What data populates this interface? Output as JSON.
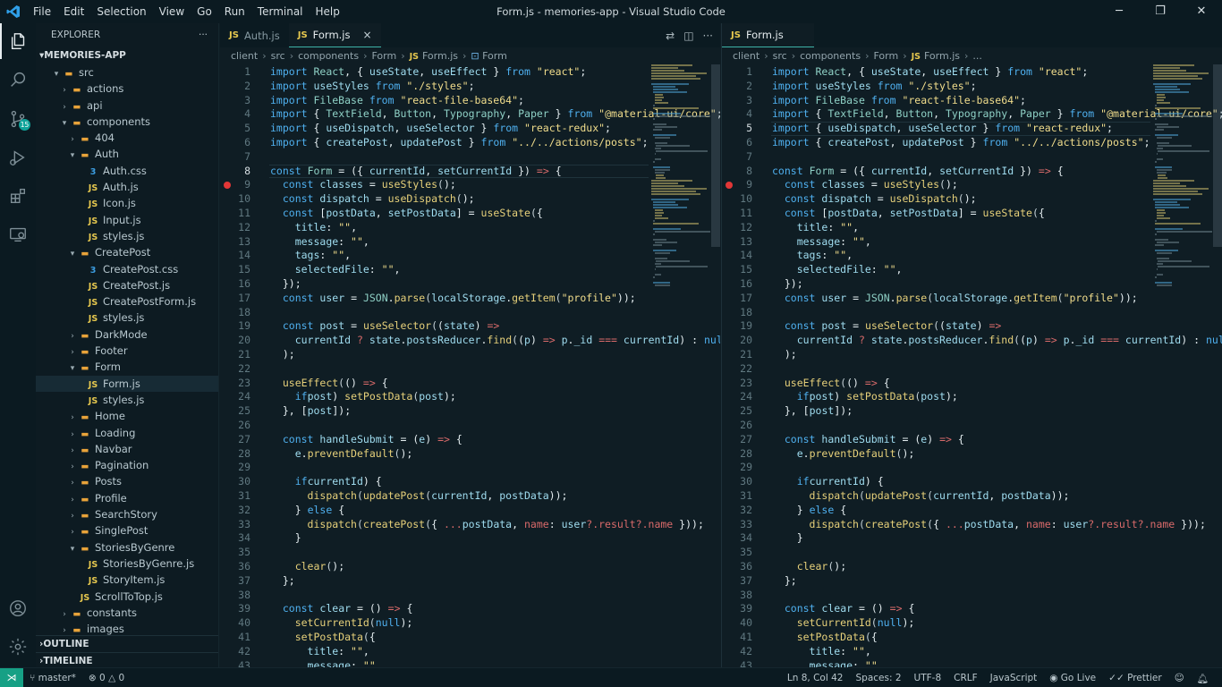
{
  "window": {
    "title": "Form.js - memories-app - Visual Studio Code",
    "menu": [
      "File",
      "Edit",
      "Selection",
      "View",
      "Go",
      "Run",
      "Terminal",
      "Help"
    ]
  },
  "activity": {
    "scm_badge": "15"
  },
  "sidebar": {
    "header": "EXPLORER",
    "more": "···",
    "project": "MEMORIES-APP",
    "tree": [
      {
        "label": "src",
        "kind": "folder",
        "depth": 1,
        "open": true
      },
      {
        "label": "actions",
        "kind": "folder",
        "depth": 2,
        "open": false
      },
      {
        "label": "api",
        "kind": "folder",
        "depth": 2,
        "open": false
      },
      {
        "label": "components",
        "kind": "folder",
        "depth": 2,
        "open": true
      },
      {
        "label": "404",
        "kind": "folder",
        "depth": 3,
        "open": false
      },
      {
        "label": "Auth",
        "kind": "folder",
        "depth": 3,
        "open": true
      },
      {
        "label": "Auth.css",
        "kind": "css",
        "depth": 4
      },
      {
        "label": "Auth.js",
        "kind": "js",
        "depth": 4
      },
      {
        "label": "Icon.js",
        "kind": "js",
        "depth": 4
      },
      {
        "label": "Input.js",
        "kind": "js",
        "depth": 4
      },
      {
        "label": "styles.js",
        "kind": "js",
        "depth": 4
      },
      {
        "label": "CreatePost",
        "kind": "folder",
        "depth": 3,
        "open": true
      },
      {
        "label": "CreatePost.css",
        "kind": "css",
        "depth": 4
      },
      {
        "label": "CreatePost.js",
        "kind": "js",
        "depth": 4
      },
      {
        "label": "CreatePostForm.js",
        "kind": "js",
        "depth": 4
      },
      {
        "label": "styles.js",
        "kind": "js",
        "depth": 4
      },
      {
        "label": "DarkMode",
        "kind": "folder",
        "depth": 3,
        "open": false
      },
      {
        "label": "Footer",
        "kind": "folder",
        "depth": 3,
        "open": false
      },
      {
        "label": "Form",
        "kind": "folder",
        "depth": 3,
        "open": true
      },
      {
        "label": "Form.js",
        "kind": "js",
        "depth": 4,
        "active": true
      },
      {
        "label": "styles.js",
        "kind": "js",
        "depth": 4
      },
      {
        "label": "Home",
        "kind": "folder",
        "depth": 3,
        "open": false
      },
      {
        "label": "Loading",
        "kind": "folder",
        "depth": 3,
        "open": false
      },
      {
        "label": "Navbar",
        "kind": "folder",
        "depth": 3,
        "open": false
      },
      {
        "label": "Pagination",
        "kind": "folder",
        "depth": 3,
        "open": false
      },
      {
        "label": "Posts",
        "kind": "folder",
        "depth": 3,
        "open": false
      },
      {
        "label": "Profile",
        "kind": "folder",
        "depth": 3,
        "open": false
      },
      {
        "label": "SearchStory",
        "kind": "folder",
        "depth": 3,
        "open": false
      },
      {
        "label": "SinglePost",
        "kind": "folder",
        "depth": 3,
        "open": false
      },
      {
        "label": "StoriesByGenre",
        "kind": "folder",
        "depth": 3,
        "open": true
      },
      {
        "label": "StoriesByGenre.js",
        "kind": "js",
        "depth": 4
      },
      {
        "label": "StoryItem.js",
        "kind": "js",
        "depth": 4
      },
      {
        "label": "ScrollToTop.js",
        "kind": "js",
        "depth": 3
      },
      {
        "label": "constants",
        "kind": "folder",
        "depth": 2,
        "open": false
      },
      {
        "label": "images",
        "kind": "folder",
        "depth": 2,
        "open": false
      }
    ],
    "outline": "OUTLINE",
    "timeline": "TIMELINE"
  },
  "editor_left": {
    "tabs": [
      {
        "label": "Auth.js",
        "active": false
      },
      {
        "label": "Form.js",
        "active": true
      }
    ],
    "close_glyph": "×",
    "breadcrumb": [
      "client",
      "src",
      "components",
      "Form",
      "Form.js",
      "Form"
    ],
    "cursor_line": 8
  },
  "editor_right": {
    "tabs": [
      {
        "label": "Form.js",
        "active": true
      }
    ],
    "breadcrumb": [
      "client",
      "src",
      "components",
      "Form",
      "Form.js",
      "..."
    ],
    "cursor_line": 5
  },
  "code_lines": [
    "import React, { useState, useEffect } from \"react\";",
    "import useStyles from \"./styles\";",
    "import FileBase from \"react-file-base64\";",
    "import { TextField, Button, Typography, Paper } from \"@material-ui/core\";",
    "import { useDispatch, useSelector } from \"react-redux\";",
    "import { createPost, updatePost } from \"../../actions/posts\";",
    "",
    "const Form = ({ currentId, setCurrentId }) => {",
    "  const classes = useStyles();",
    "  const dispatch = useDispatch();",
    "  const [postData, setPostData] = useState({",
    "    title: \"\",",
    "    message: \"\",",
    "    tags: \"\",",
    "    selectedFile: \"\",",
    "  });",
    "  const user = JSON.parse(localStorage.getItem(\"profile\"));",
    "",
    "  const post = useSelector((state) =>",
    "    currentId ? state.postsReducer.find((p) => p._id === currentId) : null",
    "  );",
    "",
    "  useEffect(() => {",
    "    if (post) setPostData(post);",
    "  }, [post]);",
    "",
    "  const handleSubmit = (e) => {",
    "    e.preventDefault();",
    "",
    "    if (currentId) {",
    "      dispatch(updatePost(currentId, postData));",
    "    } else {",
    "      dispatch(createPost({ ...postData, name: user?.result?.name }));",
    "    }",
    "",
    "    clear();",
    "  };",
    "",
    "  const clear = () => {",
    "    setCurrentId(null);",
    "    setPostData({",
    "      title: \"\",",
    "      message: \"\","
  ],
  "breakpoint_line": 9,
  "status": {
    "branch": "master*",
    "problems": "⊗ 0 △ 0",
    "position": "Ln 8, Col 42",
    "spaces": "Spaces: 2",
    "encoding": "UTF-8",
    "eol": "CRLF",
    "language": "JavaScript",
    "golive": "Go Live",
    "prettier": "Prettier"
  }
}
